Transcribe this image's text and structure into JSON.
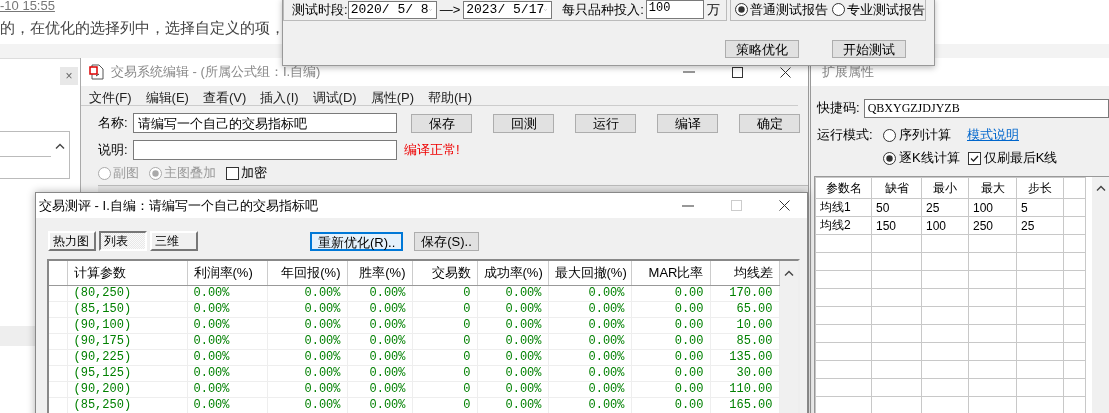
{
  "background_page": {
    "link": "-10 15:55",
    "text": "的，在优化的选择列中，选择自定义的项，",
    "panel_close": "×"
  },
  "test_dialog": {
    "period_label": "测试时段:",
    "start_date": "2020/ 5/ 8",
    "arrow": "—>",
    "end_date": "2023/ 5/17",
    "investment_label": "每只品种投入:",
    "investment": "100",
    "unit": "万",
    "report_types": [
      {
        "label": "普通测试报告",
        "selected": true
      },
      {
        "label": "专业测试报告",
        "selected": false
      }
    ],
    "buttons": [
      "策略优化",
      "开始测试"
    ]
  },
  "editor": {
    "title": "交易系统编辑 - (所属公式组：I.自编)",
    "menu": [
      "文件(F)",
      "编辑(E)",
      "查看(V)",
      "插入(I)",
      "调试(D)",
      "属性(P)",
      "帮助(H)"
    ],
    "name_label": "名称:",
    "name": "请编写一个自己的交易指标吧",
    "description_label": "说明:",
    "buttons": [
      "保存",
      "回测",
      "运行",
      "编译",
      "确定"
    ],
    "compile_status": "编译正常!",
    "display_options": [
      {
        "kind": "radio",
        "label": "副图",
        "selected": false,
        "disabled": true
      },
      {
        "kind": "radio",
        "label": "主图叠加",
        "selected": true,
        "disabled": true
      },
      {
        "kind": "checkbox",
        "label": "加密",
        "checked": false
      }
    ]
  },
  "extended_properties": {
    "title": "扩展属性",
    "shortcut_label": "快捷码:",
    "shortcut": "QBXYGZJDJYZB",
    "run_mode_label": "运行模式:",
    "run_modes": [
      {
        "label": "序列计算",
        "selected": false
      },
      {
        "label": "逐K线计算",
        "selected": true
      }
    ],
    "help_link": "模式说明",
    "refresh_last": {
      "label": "仅刷最后K线",
      "checked": true
    },
    "columns": [
      "参数名",
      "缺省",
      "最小",
      "最大",
      "步长"
    ],
    "rows": [
      [
        "均线1",
        "50",
        "25",
        "100",
        "5"
      ],
      [
        "均线2",
        "150",
        "100",
        "250",
        "25"
      ]
    ]
  },
  "evaluation": {
    "title": "交易测评 - I.自编：请编写一个自己的交易指标吧",
    "view_tabs": [
      {
        "label": "热力图",
        "selected": false
      },
      {
        "label": "列表",
        "selected": true
      },
      {
        "label": "三维",
        "selected": false
      }
    ],
    "buttons": [
      {
        "label": "重新优化(R)..",
        "focused": true
      },
      {
        "label": "保存(S)..",
        "focused": false
      }
    ],
    "columns": [
      "计算参数",
      "利润率(%)",
      "年回报(%)",
      "胜率(%)",
      "交易数",
      "成功率(%)",
      "最大回撤(%)",
      "MAR比率",
      "均线差"
    ],
    "rows": [
      [
        "(80,250)",
        "0.00%",
        "0.00%",
        "0.00%",
        "0",
        "0.00%",
        "0.00%",
        "0.00",
        "170.00"
      ],
      [
        "(85,150)",
        "0.00%",
        "0.00%",
        "0.00%",
        "0",
        "0.00%",
        "0.00%",
        "0.00",
        "65.00"
      ],
      [
        "(90,100)",
        "0.00%",
        "0.00%",
        "0.00%",
        "0",
        "0.00%",
        "0.00%",
        "0.00",
        "10.00"
      ],
      [
        "(90,175)",
        "0.00%",
        "0.00%",
        "0.00%",
        "0",
        "0.00%",
        "0.00%",
        "0.00",
        "85.00"
      ],
      [
        "(90,225)",
        "0.00%",
        "0.00%",
        "0.00%",
        "0",
        "0.00%",
        "0.00%",
        "0.00",
        "135.00"
      ],
      [
        "(95,125)",
        "0.00%",
        "0.00%",
        "0.00%",
        "0",
        "0.00%",
        "0.00%",
        "0.00",
        "30.00"
      ],
      [
        "(90,200)",
        "0.00%",
        "0.00%",
        "0.00%",
        "0",
        "0.00%",
        "0.00%",
        "0.00",
        "110.00"
      ],
      [
        "(85,250)",
        "0.00%",
        "0.00%",
        "0.00%",
        "0",
        "0.00%",
        "0.00%",
        "0.00",
        "165.00"
      ]
    ]
  }
}
